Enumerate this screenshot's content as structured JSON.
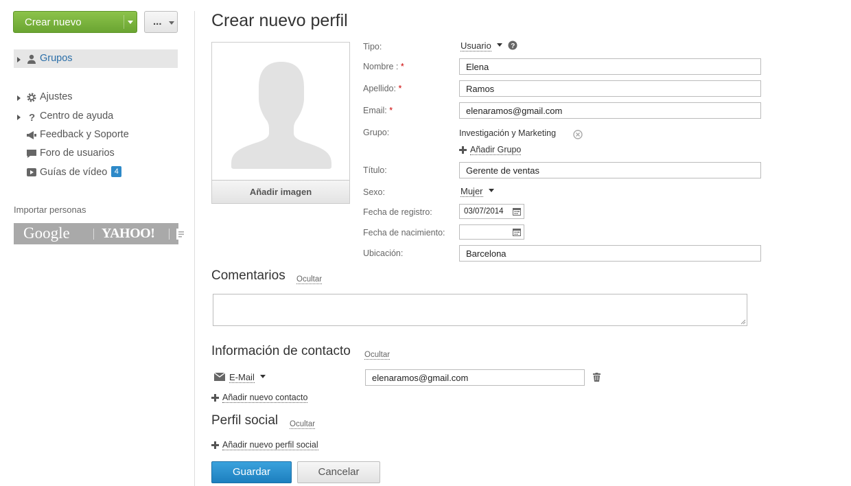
{
  "sidebar": {
    "create_button": "Crear nuevo",
    "more_button": "...",
    "nav": {
      "groups": "Grupos",
      "settings": "Ajustes",
      "help": "Centro de ayuda",
      "feedback": "Feedback y Soporte",
      "forum": "Foro de usuarios",
      "videos": "Guías de vídeo",
      "videos_badge": "4"
    },
    "import_label": "Importar personas",
    "import": {
      "google": "Google",
      "yahoo": "YAHOO!"
    }
  },
  "page_title": "Crear nuevo perfil",
  "photo": {
    "add_image": "Añadir imagen"
  },
  "form": {
    "type_label": "Tipo:",
    "type_value": "Usuario",
    "first_name_label": "Nombre :",
    "first_name_value": "Elena",
    "last_name_label": "Apellido:",
    "last_name_value": "Ramos",
    "email_label": "Email:",
    "email_value": "elenaramos@gmail.com",
    "required_mark": "*",
    "group_label": "Grupo:",
    "group_value": "Investigación y Marketing",
    "add_group": "Añadir Grupo",
    "title_label": "Título:",
    "title_value": "Gerente de ventas",
    "sex_label": "Sexo:",
    "sex_value": "Mujer",
    "reg_date_label": "Fecha de registro:",
    "reg_date_value": "03/07/2014",
    "birth_date_label": "Fecha de nacimiento:",
    "birth_date_value": "",
    "location_label": "Ubicación:",
    "location_value": "Barcelona"
  },
  "comments": {
    "title": "Comentarios",
    "hide": "Ocultar",
    "value": ""
  },
  "contact": {
    "title": "Información de contacto",
    "hide": "Ocultar",
    "type": "E-Mail",
    "value": "elenaramos@gmail.com",
    "add": "Añadir nuevo contacto"
  },
  "social": {
    "title": "Perfil social",
    "hide": "Ocultar",
    "add": "Añadir nuevo perfil social"
  },
  "actions": {
    "save": "Guardar",
    "cancel": "Cancelar"
  },
  "colors": {
    "accent_green": "#7ab63f",
    "accent_blue": "#2a8fcf",
    "required": "#cc0000"
  }
}
